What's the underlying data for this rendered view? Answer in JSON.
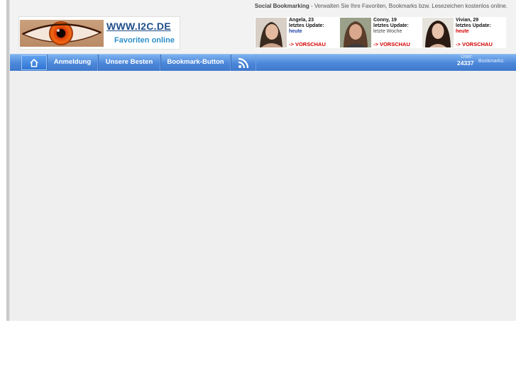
{
  "header": {
    "tagline_bold": "Social Bookmarking",
    "tagline_rest": " - Verwalten Sie Ihre Favoriten, Bookmarks bzw. Lesezeichen kostenlos online."
  },
  "logo": {
    "url_text": "WWW.I2C.DE",
    "subtitle": "Favoriten online"
  },
  "banner": {
    "profiles": [
      {
        "name_age": "Angela, 23",
        "update_label": "letztes Update:",
        "update_value": "heute",
        "cta": "-> VORSCHAU"
      },
      {
        "name_age": "Conny, 19",
        "update_label": "letztes Update:",
        "update_value": "letzte Woche",
        "cta": "-> VORSCHAU"
      },
      {
        "name_age": "Vivian, 29",
        "update_label": "letztes Update:",
        "update_value": "heute",
        "cta": "-> VORSCHAU"
      }
    ]
  },
  "nav": {
    "home_icon": "home-icon",
    "items": [
      "Anmeldung",
      "Unsere Besten",
      "Bookmark-Button"
    ],
    "rss_icon": "rss-icon",
    "user_label": "User:",
    "user_count": "24337",
    "bookmarks_label": "Bookmarks:"
  },
  "colors": {
    "nav_top": "#7fb3ef",
    "nav_bottom": "#3f79cc",
    "content_bg": "#efefef",
    "header_bg": "#f2f2f2",
    "logo_url": "#1f4e8a",
    "logo_sub": "#2d8fc9",
    "cta_red": "#d40000"
  }
}
